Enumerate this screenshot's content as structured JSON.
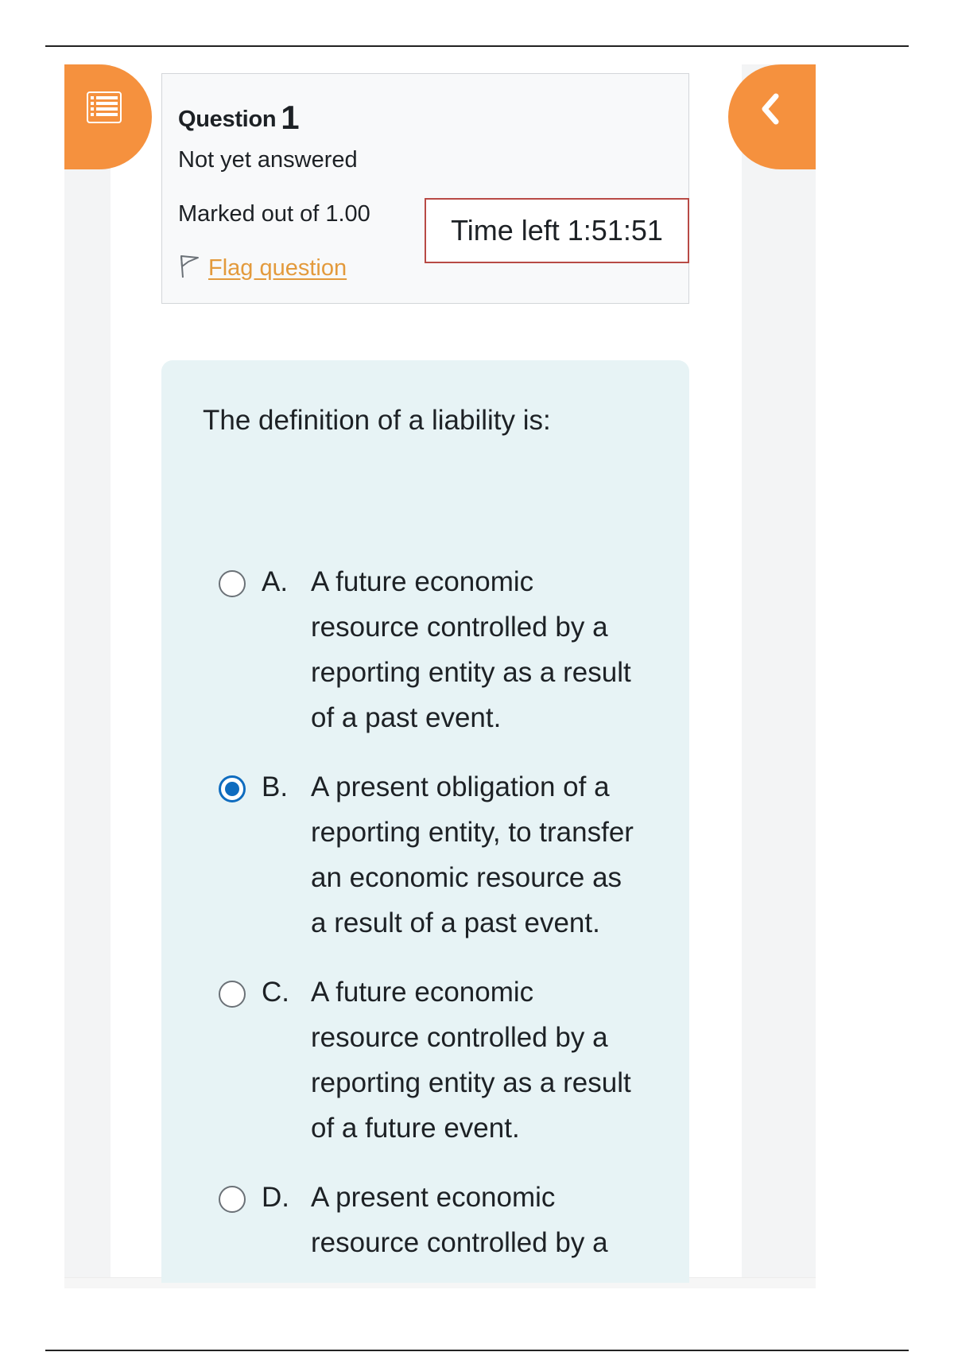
{
  "nav": {
    "left_drawer_icon": "list-icon",
    "right_drawer_icon": "chevron-left-icon"
  },
  "question_info": {
    "title_prefix": "Question",
    "number": "1",
    "state": "Not yet answered",
    "grade": "Marked out of 1.00",
    "flag_label": "Flag question",
    "flag_icon": "flag-icon"
  },
  "timer": {
    "text": "Time left 1:51:51"
  },
  "question": {
    "text": "The definition of a liability is:",
    "selected": "B",
    "options": [
      {
        "letter": "A.",
        "text": "A future economic resource controlled by a reporting entity as a result of a past event.",
        "checked": false
      },
      {
        "letter": "B.",
        "text": "A present obligation of a reporting entity, to transfer an economic resource as a result of a past event.",
        "checked": true
      },
      {
        "letter": "C.",
        "text": "A future economic resource controlled by a reporting entity as a result of a future event.",
        "checked": false
      },
      {
        "letter": "D.",
        "text": "A present economic resource controlled by a",
        "checked": false
      }
    ]
  },
  "colors": {
    "accent_orange": "#f5913e",
    "radio_selected": "#0f6cbf",
    "link_orange": "#e39a3c",
    "timer_border": "#b84a45",
    "content_bg": "#e7f3f5"
  }
}
